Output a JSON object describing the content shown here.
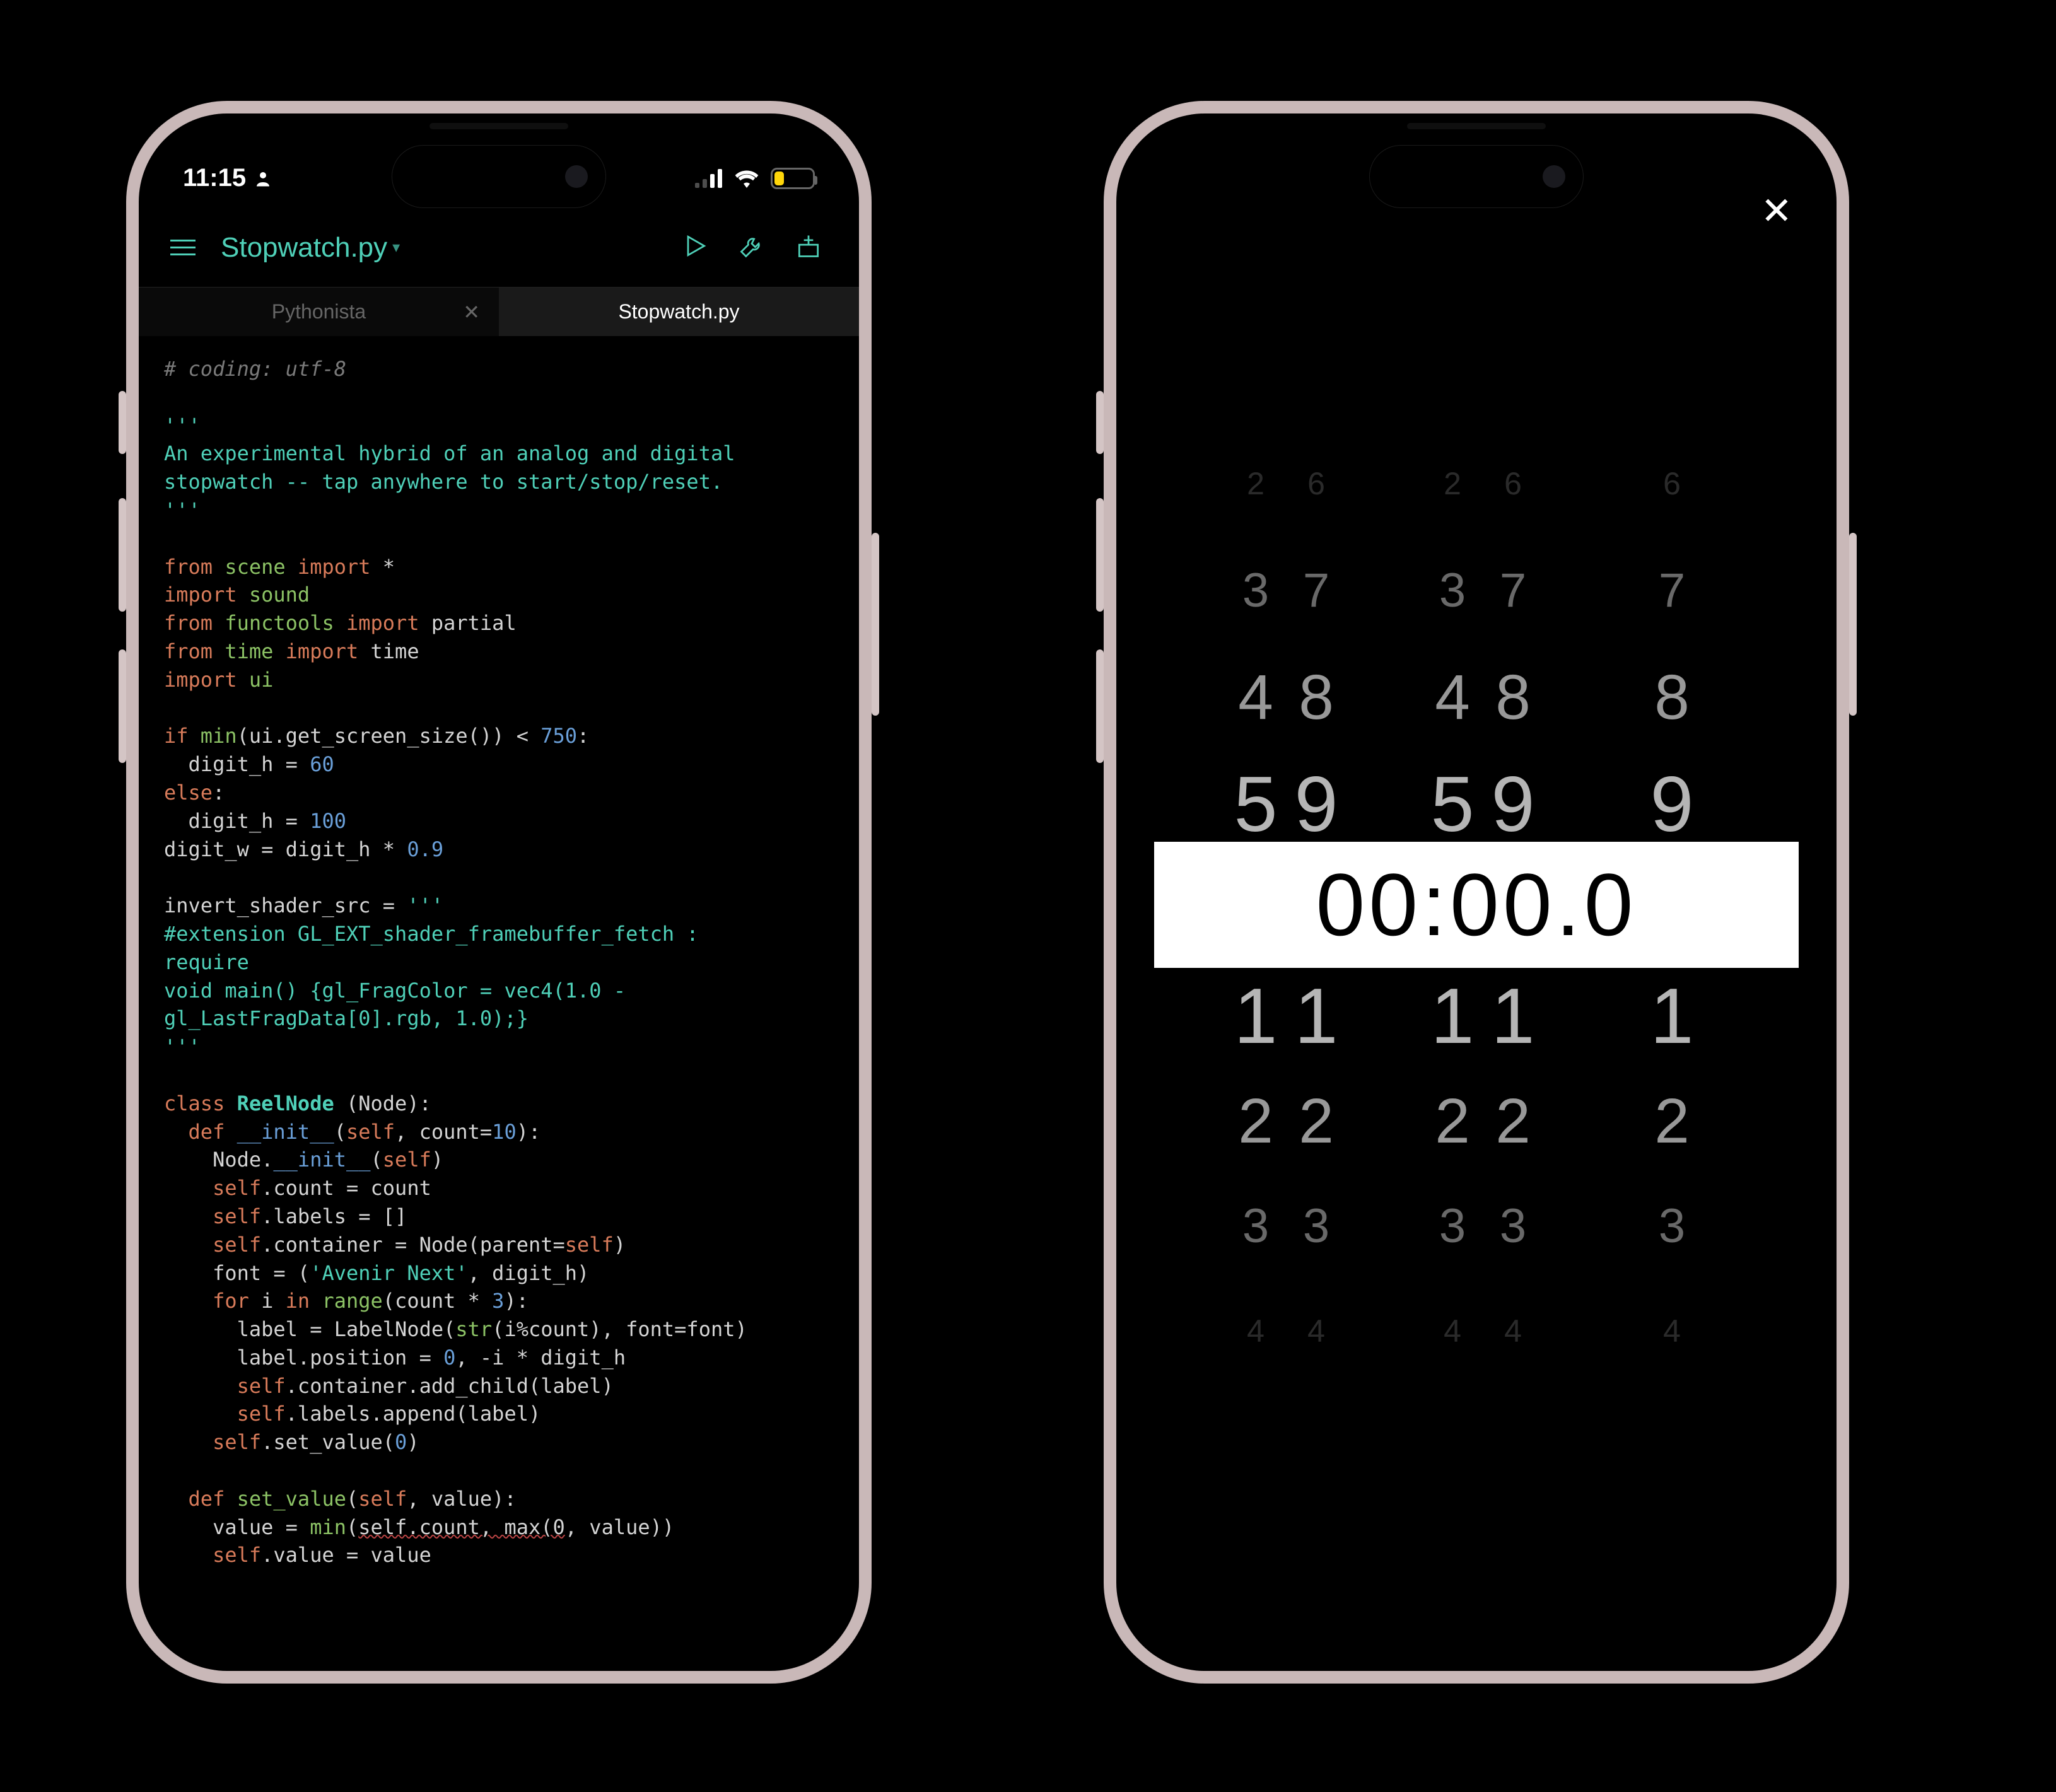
{
  "statusbar": {
    "time": "11:15",
    "battery_percent": "25"
  },
  "toolbar": {
    "title": "Stopwatch.py"
  },
  "tabs": [
    {
      "label": "Pythonista",
      "active": false
    },
    {
      "label": "Stopwatch.py",
      "active": true
    }
  ],
  "code_lines": [
    [
      [
        "c-comment",
        "# coding: utf-8"
      ]
    ],
    [],
    [
      [
        "c-string",
        "'''"
      ]
    ],
    [
      [
        "c-string",
        "An experimental hybrid of an analog and digital"
      ]
    ],
    [
      [
        "c-string",
        "stopwatch -- tap anywhere to start/stop/reset."
      ]
    ],
    [
      [
        "c-string",
        "'''"
      ]
    ],
    [],
    [
      [
        "c-keyword",
        "from"
      ],
      [
        "c-plain",
        " "
      ],
      [
        "c-module",
        "scene"
      ],
      [
        "c-plain",
        " "
      ],
      [
        "c-keyword",
        "import"
      ],
      [
        "c-plain",
        " *"
      ]
    ],
    [
      [
        "c-keyword",
        "import"
      ],
      [
        "c-plain",
        " "
      ],
      [
        "c-module",
        "sound"
      ]
    ],
    [
      [
        "c-keyword",
        "from"
      ],
      [
        "c-plain",
        " "
      ],
      [
        "c-module",
        "functools"
      ],
      [
        "c-plain",
        " "
      ],
      [
        "c-keyword",
        "import"
      ],
      [
        "c-plain",
        " partial"
      ]
    ],
    [
      [
        "c-keyword",
        "from"
      ],
      [
        "c-plain",
        " "
      ],
      [
        "c-module",
        "time"
      ],
      [
        "c-plain",
        " "
      ],
      [
        "c-keyword",
        "import"
      ],
      [
        "c-plain",
        " time"
      ]
    ],
    [
      [
        "c-keyword",
        "import"
      ],
      [
        "c-plain",
        " "
      ],
      [
        "c-module",
        "ui"
      ]
    ],
    [],
    [
      [
        "c-keyword",
        "if"
      ],
      [
        "c-plain",
        " "
      ],
      [
        "c-builtin",
        "min"
      ],
      [
        "c-plain",
        "(ui.get_screen_size()) < "
      ],
      [
        "c-num",
        "750"
      ],
      [
        "c-plain",
        ":"
      ]
    ],
    [
      [
        "c-plain",
        "  digit_h = "
      ],
      [
        "c-num",
        "60"
      ]
    ],
    [
      [
        "c-keyword",
        "else"
      ],
      [
        "c-plain",
        ":"
      ]
    ],
    [
      [
        "c-plain",
        "  digit_h = "
      ],
      [
        "c-num",
        "100"
      ]
    ],
    [
      [
        "c-plain",
        "digit_w = digit_h * "
      ],
      [
        "c-num",
        "0.9"
      ]
    ],
    [],
    [
      [
        "c-plain",
        "invert_shader_src = "
      ],
      [
        "c-string",
        "'''"
      ]
    ],
    [
      [
        "c-string",
        "#extension GL_EXT_shader_framebuffer_fetch : "
      ]
    ],
    [
      [
        "c-string",
        "require"
      ]
    ],
    [
      [
        "c-string",
        "void main() {gl_FragColor = vec4(1.0 - "
      ]
    ],
    [
      [
        "c-string",
        "gl_LastFragData[0].rgb, 1.0);}"
      ]
    ],
    [
      [
        "c-string",
        "'''"
      ]
    ],
    [],
    [
      [
        "c-keyword",
        "class"
      ],
      [
        "c-plain",
        " "
      ],
      [
        "c-class",
        "ReelNode"
      ],
      [
        "c-plain",
        " (Node):"
      ]
    ],
    [
      [
        "c-plain",
        "  "
      ],
      [
        "c-keyword",
        "def"
      ],
      [
        "c-plain",
        " "
      ],
      [
        "c-dunder",
        "__init__"
      ],
      [
        "c-plain",
        "("
      ],
      [
        "c-self",
        "self"
      ],
      [
        "c-plain",
        ", count="
      ],
      [
        "c-num",
        "10"
      ],
      [
        "c-plain",
        "):"
      ]
    ],
    [
      [
        "c-plain",
        "    Node."
      ],
      [
        "c-dunder",
        "__init__"
      ],
      [
        "c-plain",
        "("
      ],
      [
        "c-self",
        "self"
      ],
      [
        "c-plain",
        ")"
      ]
    ],
    [
      [
        "c-plain",
        "    "
      ],
      [
        "c-self",
        "self"
      ],
      [
        "c-plain",
        ".count = count"
      ]
    ],
    [
      [
        "c-plain",
        "    "
      ],
      [
        "c-self",
        "self"
      ],
      [
        "c-plain",
        ".labels = []"
      ]
    ],
    [
      [
        "c-plain",
        "    "
      ],
      [
        "c-self",
        "self"
      ],
      [
        "c-plain",
        ".container = Node(parent="
      ],
      [
        "c-self",
        "self"
      ],
      [
        "c-plain",
        ")"
      ]
    ],
    [
      [
        "c-plain",
        "    font = ("
      ],
      [
        "c-string",
        "'Avenir Next'"
      ],
      [
        "c-plain",
        ", digit_h)"
      ]
    ],
    [
      [
        "c-plain",
        "    "
      ],
      [
        "c-keyword",
        "for"
      ],
      [
        "c-plain",
        " i "
      ],
      [
        "c-keyword",
        "in"
      ],
      [
        "c-plain",
        " "
      ],
      [
        "c-builtin",
        "range"
      ],
      [
        "c-plain",
        "(count * "
      ],
      [
        "c-num",
        "3"
      ],
      [
        "c-plain",
        "):"
      ]
    ],
    [
      [
        "c-plain",
        "      label = LabelNode("
      ],
      [
        "c-builtin",
        "str"
      ],
      [
        "c-plain",
        "(i%count), font=font)"
      ]
    ],
    [
      [
        "c-plain",
        "      label.position = "
      ],
      [
        "c-num",
        "0"
      ],
      [
        "c-plain",
        ", -i * digit_h"
      ]
    ],
    [
      [
        "c-plain",
        "      "
      ],
      [
        "c-self",
        "self"
      ],
      [
        "c-plain",
        ".container.add_child(label)"
      ]
    ],
    [
      [
        "c-plain",
        "      "
      ],
      [
        "c-self",
        "self"
      ],
      [
        "c-plain",
        ".labels.append(label)"
      ]
    ],
    [
      [
        "c-plain",
        "    "
      ],
      [
        "c-self",
        "self"
      ],
      [
        "c-plain",
        ".set_value("
      ],
      [
        "c-num",
        "0"
      ],
      [
        "c-plain",
        ")"
      ]
    ],
    [],
    [
      [
        "c-plain",
        "  "
      ],
      [
        "c-keyword",
        "def"
      ],
      [
        "c-plain",
        " "
      ],
      [
        "c-func",
        "set_value"
      ],
      [
        "c-plain",
        "("
      ],
      [
        "c-self",
        "self"
      ],
      [
        "c-plain",
        ", value):"
      ]
    ],
    [
      [
        "c-plain",
        "    value = "
      ],
      [
        "c-builtin",
        "min"
      ],
      [
        "c-plain",
        "("
      ],
      [
        "underline-err",
        "self.count, max(0"
      ],
      [
        "c-plain",
        ", value))"
      ]
    ],
    [
      [
        "c-plain",
        "    "
      ],
      [
        "c-self",
        "self"
      ],
      [
        "c-plain",
        ".value = value"
      ]
    ]
  ],
  "stopwatch": {
    "display": "00:00.0",
    "reels": [
      {
        "offset": -4,
        "opacity": 0.22,
        "size": 50,
        "row": [
          "2",
          "6",
          "2",
          "6",
          "6"
        ]
      },
      {
        "offset": -3,
        "opacity": 0.55,
        "size": 76,
        "row": [
          "3",
          "7",
          "3",
          "7",
          "7"
        ]
      },
      {
        "offset": -2,
        "opacity": 0.8,
        "size": 100,
        "row": [
          "4",
          "8",
          "4",
          "8",
          "8"
        ]
      },
      {
        "offset": -1,
        "opacity": 0.95,
        "size": 124,
        "row": [
          "5",
          "9",
          "5",
          "9",
          "9"
        ]
      },
      {
        "offset": 0,
        "opacity": 1.0,
        "size": 140,
        "row": [
          "0",
          "0",
          ":",
          "0",
          "0",
          ".",
          "0"
        ]
      },
      {
        "offset": 1,
        "opacity": 0.95,
        "size": 124,
        "row": [
          "1",
          "1",
          "1",
          "1",
          "1"
        ]
      },
      {
        "offset": 2,
        "opacity": 0.8,
        "size": 100,
        "row": [
          "2",
          "2",
          "2",
          "2",
          "2"
        ]
      },
      {
        "offset": 3,
        "opacity": 0.55,
        "size": 76,
        "row": [
          "3",
          "3",
          "3",
          "3",
          "3"
        ]
      },
      {
        "offset": 4,
        "opacity": 0.22,
        "size": 50,
        "row": [
          "4",
          "4",
          "4",
          "4",
          "4"
        ]
      }
    ]
  }
}
